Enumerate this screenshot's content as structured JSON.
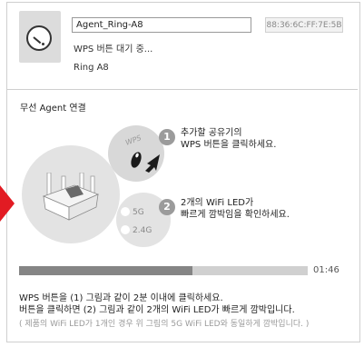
{
  "device": {
    "name_value": "Agent_Ring-A8",
    "mac": "88:36:6C:FF:7E:5B",
    "status": "WPS 버튼 대기 중...",
    "model": "Ring A8"
  },
  "section": {
    "title": "무선 Agent 연결"
  },
  "illustration": {
    "wps_tag": "WPS",
    "step1_number": "1",
    "step1_line1": "추가할 공유기의",
    "step1_line2": "WPS 버튼을 클릭하세요.",
    "step2_number": "2",
    "step2_line1": "2개의 WiFi LED가",
    "step2_line2": "빠르게 깜박임을 확인하세요.",
    "led_5g": "5G",
    "led_24g": "2.4G"
  },
  "progress": {
    "fraction": 0.6,
    "time": "01:46"
  },
  "notes": {
    "line1": "WPS 버튼을 (1) 그림과 같이 2분 이내에 클릭하세요.",
    "line2": "버튼을 클릭하면 (2) 그림과 같이 2개의 WiFi LED가 빠르게 깜박입니다.",
    "line3": "( 제품의 WiFi LED가 1개인 경우 위 그림의 5G WiFi LED와 동일하게 깜박입니다. )"
  },
  "colors": {
    "accent_red": "#e21b23",
    "progress_fill": "#858585",
    "progress_track": "#d0d0d0"
  }
}
